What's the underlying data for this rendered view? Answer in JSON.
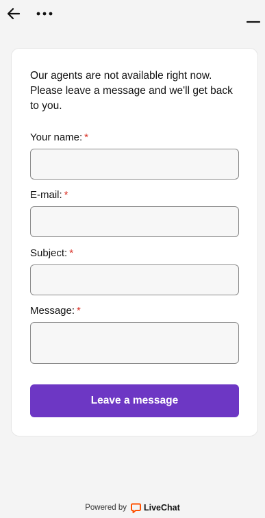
{
  "header": {
    "back_icon": "arrow-left-icon",
    "more_icon": "more-horizontal-icon",
    "minimize_icon": "minimize-icon"
  },
  "form": {
    "intro": "Our agents are not available right now. Please leave a message and we'll get back to you.",
    "required_marker": "*",
    "fields": [
      {
        "label": "Your name:",
        "value": ""
      },
      {
        "label": "E-mail:",
        "value": ""
      },
      {
        "label": "Subject:",
        "value": ""
      },
      {
        "label": "Message:",
        "value": ""
      }
    ],
    "submit_label": "Leave a message"
  },
  "footer": {
    "powered_by": "Powered by",
    "brand": "LiveChat",
    "brand_icon": "chat-bubble-icon"
  },
  "colors": {
    "accent": "#6d37c4",
    "required": "#d93025",
    "brand_orange": "#ff5100",
    "background": "#f4f4f4",
    "card": "#ffffff"
  }
}
